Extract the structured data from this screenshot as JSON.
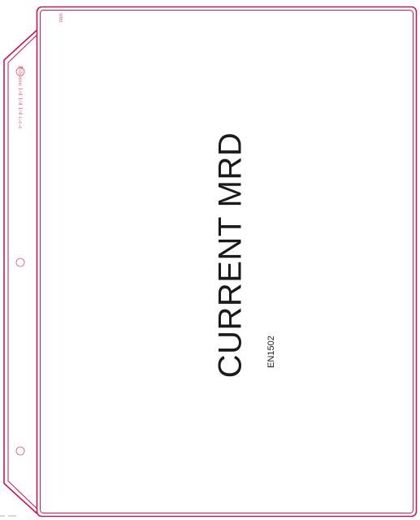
{
  "tab": {
    "title": "CURRENT MRD",
    "form_code": "EN1502",
    "brand_text": "Bibbero 1/4 1/4 1/4 c-c-c",
    "corner_code": "S881"
  },
  "colors": {
    "border": "#c2185b",
    "background": "#ffffff",
    "text": "#1a1a1a",
    "accent_text": "#d05a70"
  }
}
